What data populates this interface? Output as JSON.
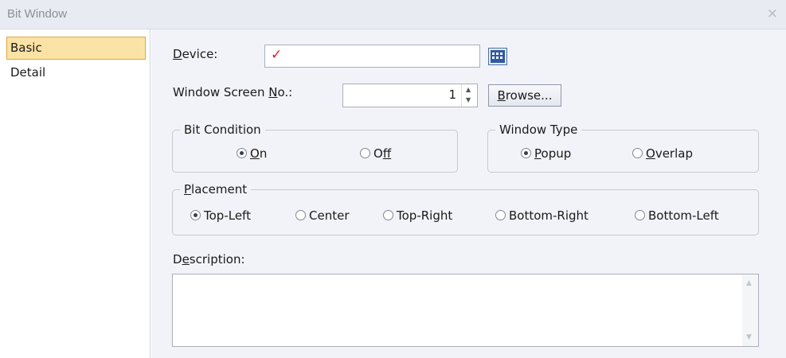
{
  "window": {
    "title": "Bit Window",
    "close_glyph": "×"
  },
  "nav": {
    "items": [
      {
        "label": "Basic",
        "selected": true
      },
      {
        "label": "Detail",
        "selected": false
      }
    ]
  },
  "device": {
    "label_first": "D",
    "label_rest": "evice:",
    "value_glyph": "✓",
    "browse_icon": "device-browse-icon"
  },
  "screen_no": {
    "label_pre": "Window Screen ",
    "label_u": "N",
    "label_post": "o.:",
    "value": "1",
    "up_glyph": "▲",
    "down_glyph": "▼"
  },
  "browse_button": {
    "label_first": "B",
    "label_rest": "rowse..."
  },
  "bit_condition": {
    "title": "Bit Condition",
    "options": [
      {
        "u": "O",
        "rest": "n",
        "checked": true
      },
      {
        "pre": "O",
        "u": "f",
        "rest": "f",
        "checked": false
      }
    ]
  },
  "window_type": {
    "title": "Window Type",
    "options": [
      {
        "u": "P",
        "rest": "opup",
        "checked": true
      },
      {
        "u": "O",
        "rest": "verlap",
        "checked": false
      }
    ]
  },
  "placement": {
    "title_u": "P",
    "title_rest": "lacement",
    "options": [
      {
        "label": "Top-Left",
        "checked": true
      },
      {
        "label": "Center",
        "checked": false
      },
      {
        "label": "Top-Right",
        "checked": false
      },
      {
        "label": "Bottom-Right",
        "checked": false
      },
      {
        "label": "Bottom-Left",
        "checked": false
      }
    ]
  },
  "description": {
    "label_pre": "D",
    "label_u": "e",
    "label_post": "scription:",
    "value": "",
    "scroll_up": "▲",
    "scroll_down": "▼"
  },
  "colors": {
    "accent_check": "#e02020",
    "selected_bg": "#fbe3a5",
    "selected_border": "#e5a63a",
    "panel_bg": "#f2f3f8"
  }
}
